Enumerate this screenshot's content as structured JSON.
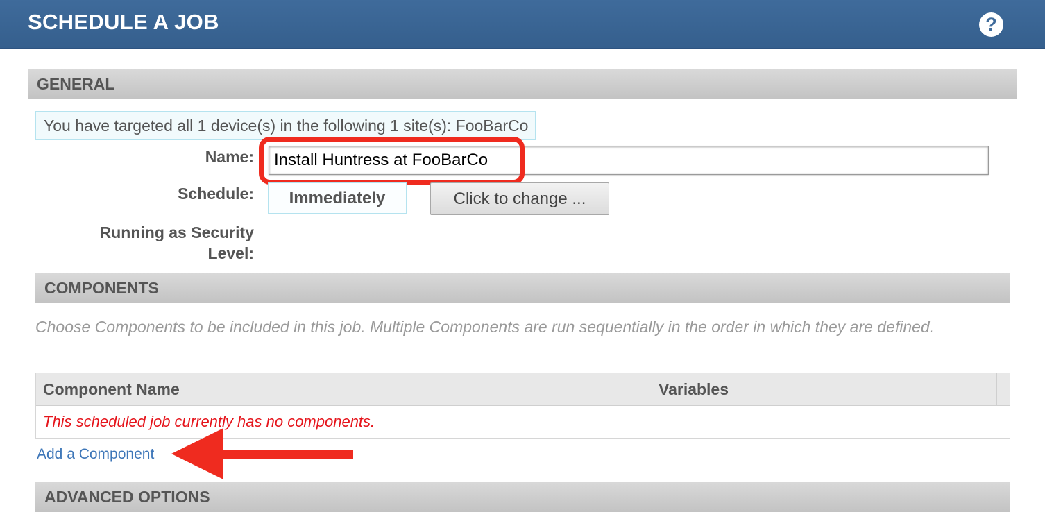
{
  "header": {
    "title": "SCHEDULE A JOB",
    "help_icon": "?"
  },
  "general": {
    "section_title": "GENERAL",
    "target_info": "You have targeted all 1 device(s) in the following 1 site(s): FooBarCo",
    "name_label": "Name:",
    "name_value": "Install Huntress at FooBarCo",
    "schedule_label": "Schedule:",
    "schedule_value": "Immediately",
    "change_button": "Click to change ...",
    "security_label_line1": "Running as Security",
    "security_label_line2": "Level:"
  },
  "components": {
    "section_title": "COMPONENTS",
    "description": "Choose Components to be included in this job. Multiple Components are run sequentially in the order in which they are defined.",
    "columns": [
      "Component Name",
      "Variables"
    ],
    "empty_message": "This scheduled job currently has no components.",
    "add_link": "Add a Component"
  },
  "advanced": {
    "section_title": "ADVANCED OPTIONS"
  },
  "colors": {
    "header_bg": "#3f6b9b",
    "annotation_red": "#ef2b1f",
    "empty_message": "#e5141b",
    "link": "#3d76b8"
  },
  "icons": {
    "help": "help-icon",
    "annotation_arrow": "left-arrow-icon"
  }
}
